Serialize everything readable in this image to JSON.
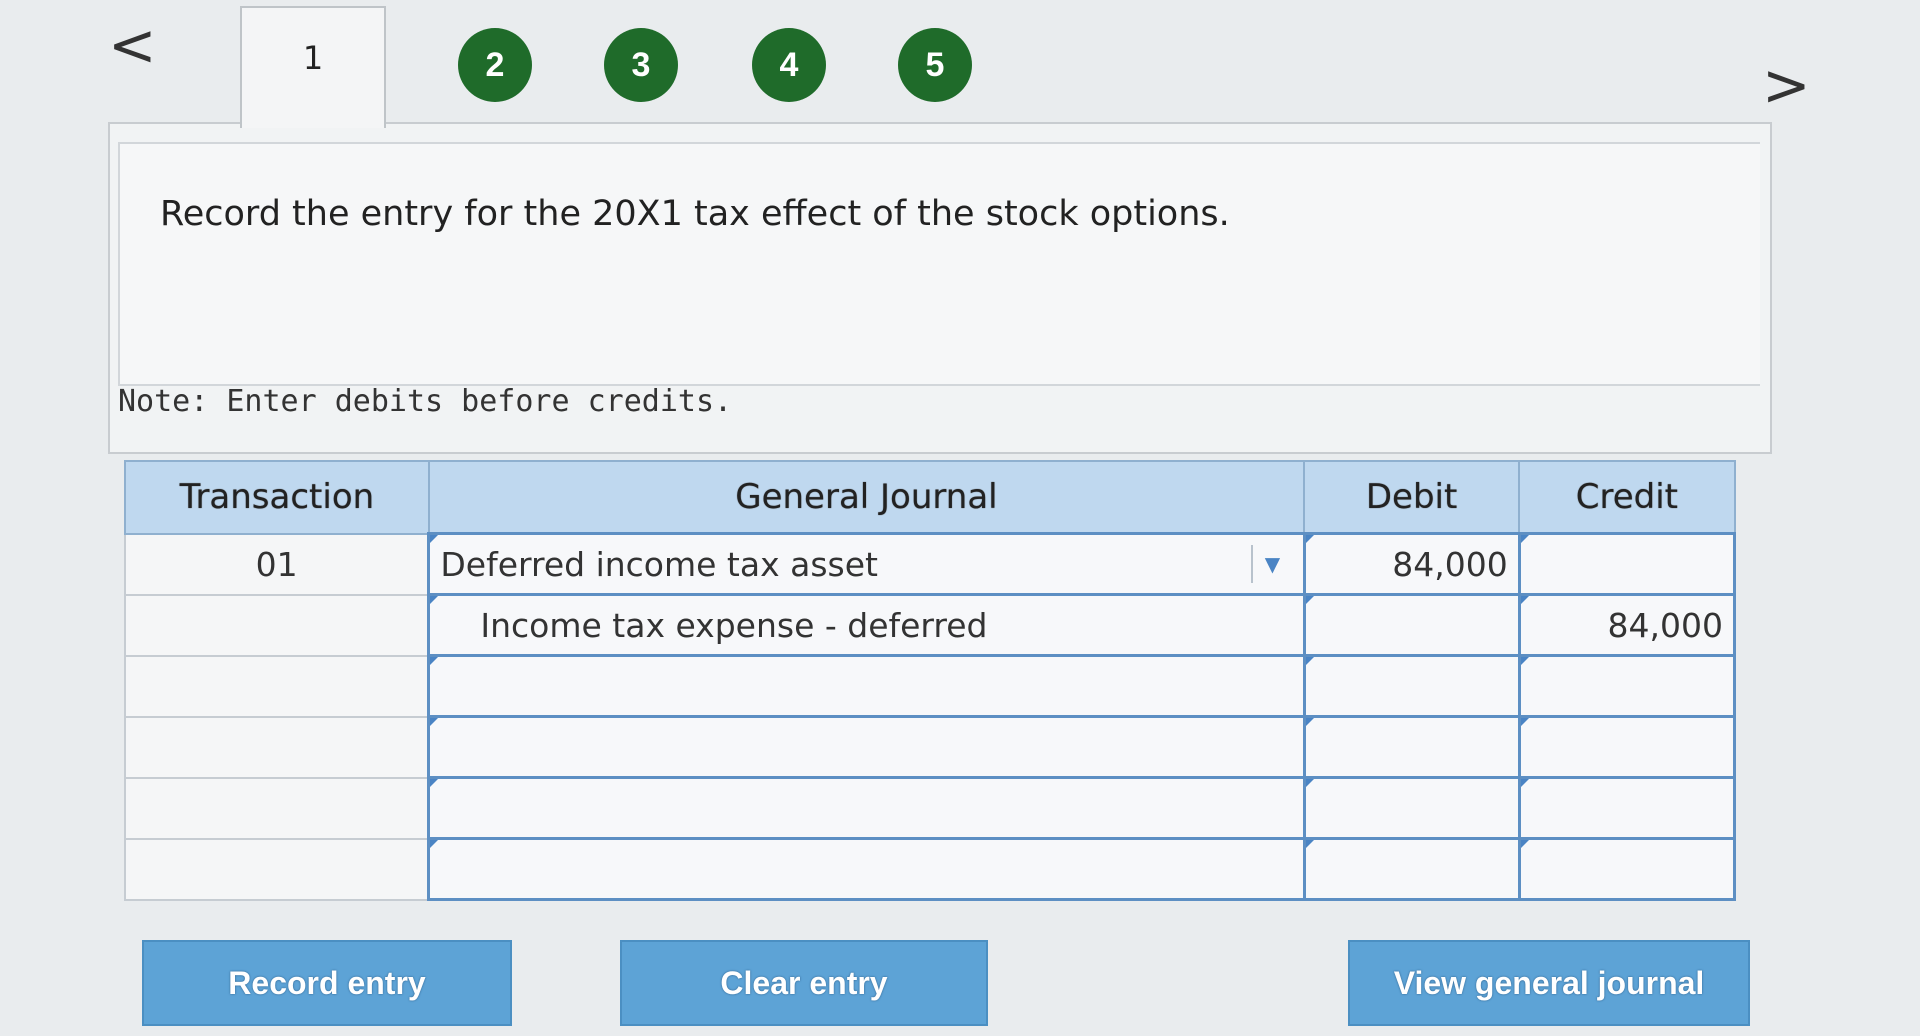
{
  "nav": {
    "prev_glyph": "<",
    "next_glyph": ">",
    "steps": [
      "1",
      "2",
      "3",
      "4",
      "5"
    ]
  },
  "instruction": "Record the entry for the 20X1 tax effect of the stock options.",
  "note": "Note: Enter debits before credits.",
  "table": {
    "headers": [
      "Transaction",
      "General Journal",
      "Debit",
      "Credit"
    ],
    "rows": [
      {
        "transaction": "01",
        "account": "Deferred income tax asset",
        "debit": "84,000",
        "credit": ""
      },
      {
        "transaction": "",
        "account": "Income tax expense - deferred",
        "debit": "",
        "credit": "84,000"
      },
      {
        "transaction": "",
        "account": "",
        "debit": "",
        "credit": ""
      },
      {
        "transaction": "",
        "account": "",
        "debit": "",
        "credit": ""
      },
      {
        "transaction": "",
        "account": "",
        "debit": "",
        "credit": ""
      },
      {
        "transaction": "",
        "account": "",
        "debit": "",
        "credit": ""
      }
    ]
  },
  "buttons": {
    "record": "Record entry",
    "clear": "Clear entry",
    "view": "View general journal"
  },
  "colors": {
    "step_green": "#1f6b2a",
    "header_blue": "#bfd8ef",
    "button_blue": "#5da3d6",
    "input_border": "#5d8fc3"
  }
}
